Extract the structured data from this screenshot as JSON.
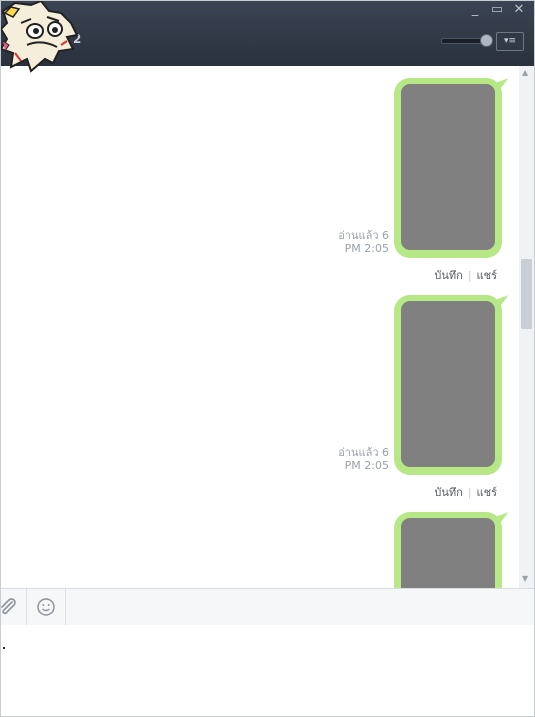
{
  "header": {
    "member_count": "2",
    "window_controls": {
      "minimize": "_",
      "maximize": "▭",
      "close": "✕"
    },
    "menu_label": "▾≡"
  },
  "messages": [
    {
      "read_status": "อ่านแล้ว 6",
      "time": "PM 2:05",
      "save_label": "บันทึก",
      "share_label": "แชร์"
    },
    {
      "read_status": "อ่านแล้ว 6",
      "time": "PM 2:05",
      "save_label": "บันทึก",
      "share_label": "แชร์"
    },
    {
      "read_status": "",
      "time": "",
      "save_label": "",
      "share_label": ""
    }
  ],
  "colors": {
    "titlebar": "#2f3643",
    "bubble": "#b6e986",
    "photo": "#808080"
  },
  "icons": {
    "attach": "paperclip-icon",
    "emoji": "smiley-icon"
  }
}
